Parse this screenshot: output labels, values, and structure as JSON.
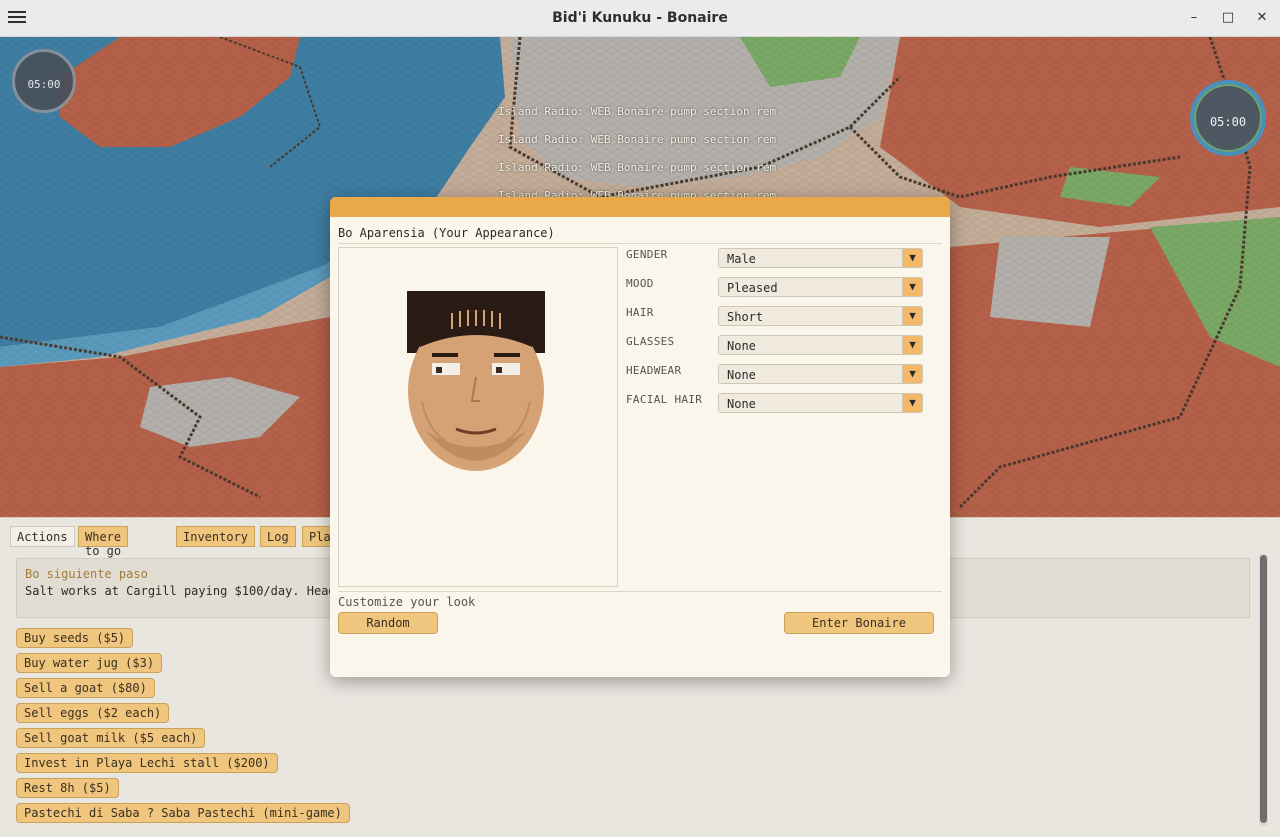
{
  "window": {
    "title": "Bid'i Kunuku - Bonaire",
    "minimize": "–",
    "maximize": "□",
    "close": "✕"
  },
  "map": {
    "radio_messages": [
      "Island Radio: WEB Bonaire pump section rem",
      "Island Radio: WEB Bonaire pump section rem",
      "Island Radio: WEB Bonaire pump section rem",
      "Island Radio: WEB Bonaire pump section rem"
    ],
    "clock_left": "05:00",
    "clock_right": "05:00",
    "colors": {
      "sea": "#3f7ea3",
      "shallow": "#5a9bbd",
      "land_red": "#b5614a",
      "land_sand": "#c7ab92",
      "road": "#4a3a2e",
      "grass": "#7aa866",
      "concrete": "#b3b0ab"
    }
  },
  "tabs": [
    "Actions",
    "Where to go",
    "Inventory",
    "Log",
    "Pla"
  ],
  "notice": {
    "title": "Bo siguiente paso",
    "body": "Salt works at Cargill paying $100/day. Head"
  },
  "actions": [
    "Buy seeds ($5)",
    "Buy water jug ($3)",
    "Sell a goat ($80)",
    "Sell eggs ($2 each)",
    "Sell goat milk ($5 each)",
    "Invest in Playa Lechi stall ($200)",
    "Rest 8h ($5)",
    "Pastechi di Saba ? Saba Pastechi (mini-game)"
  ],
  "dialog": {
    "title": "Bo Aparensia (Your Appearance)",
    "fields": [
      {
        "label": "GENDER",
        "value": "Male"
      },
      {
        "label": "MOOD",
        "value": "Pleased"
      },
      {
        "label": "HAIR",
        "value": "Short"
      },
      {
        "label": "GLASSES",
        "value": "None"
      },
      {
        "label": "HEADWEAR",
        "value": "None"
      },
      {
        "label": "FACIAL HAIR",
        "value": "None"
      }
    ],
    "dropdown_arrow": "▼",
    "customize_text": "Customize your look",
    "random_label": "Random",
    "enter_label": "Enter Bonaire",
    "accent_color": "#e9a949",
    "skin_color": "#d4a274",
    "hair_color": "#2a1a14"
  }
}
